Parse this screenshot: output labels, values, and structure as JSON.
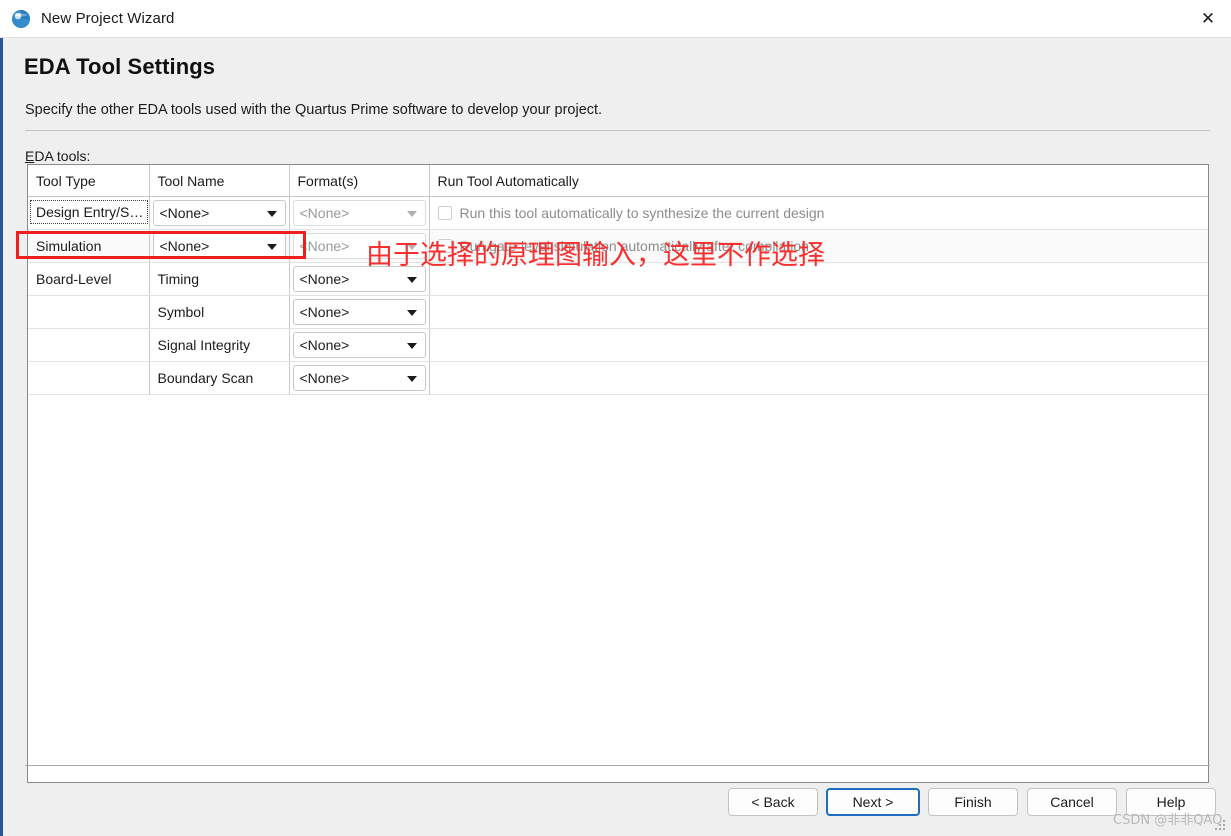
{
  "window": {
    "title": "New Project Wizard",
    "icon": "quartus-globe-icon",
    "close_label": "✕"
  },
  "page": {
    "title": "EDA Tool Settings",
    "description": "Specify the other EDA tools used with the Quartus Prime software to develop your project.",
    "field_label_mnemonic": "E",
    "field_label_rest": "DA tools:"
  },
  "table": {
    "headers": [
      "Tool Type",
      "Tool Name",
      "Format(s)",
      "Run Tool Automatically"
    ],
    "rows": [
      {
        "tool_type": "Design Entry/S…",
        "tool_name": "<None>",
        "format": "<None>",
        "format_disabled": true,
        "auto_label": "Run this tool automatically to synthesize the current design",
        "auto_checked": false,
        "has_checkbox": true
      },
      {
        "tool_type": "Simulation",
        "tool_name": "<None>",
        "format": "<None>",
        "format_disabled": true,
        "auto_label": "Run gate-level simulation automatically after compilation",
        "auto_checked": false,
        "has_checkbox": true
      },
      {
        "tool_type": "Board-Level",
        "tool_name": "Timing",
        "format": "<None>",
        "format_disabled": false,
        "auto_label": "",
        "auto_checked": false,
        "has_checkbox": false
      },
      {
        "tool_type": "",
        "tool_name": "Symbol",
        "format": "<None>",
        "format_disabled": false,
        "auto_label": "",
        "auto_checked": false,
        "has_checkbox": false
      },
      {
        "tool_type": "",
        "tool_name": "Signal Integrity",
        "format": "<None>",
        "format_disabled": false,
        "auto_label": "",
        "auto_checked": false,
        "has_checkbox": false
      },
      {
        "tool_type": "",
        "tool_name": "Boundary Scan",
        "format": "<None>",
        "format_disabled": false,
        "auto_label": "",
        "auto_checked": false,
        "has_checkbox": false
      }
    ]
  },
  "buttons": {
    "back": "< Back",
    "next": "Next >",
    "finish": "Finish",
    "cancel": "Cancel",
    "help": "Help"
  },
  "annotations": {
    "note_text": "由于选择的原理图输入，这里不作选择",
    "note_color": "#f7302f",
    "highlight_color": "#f01f1f",
    "watermark": "CSDN @非非QAQ"
  }
}
